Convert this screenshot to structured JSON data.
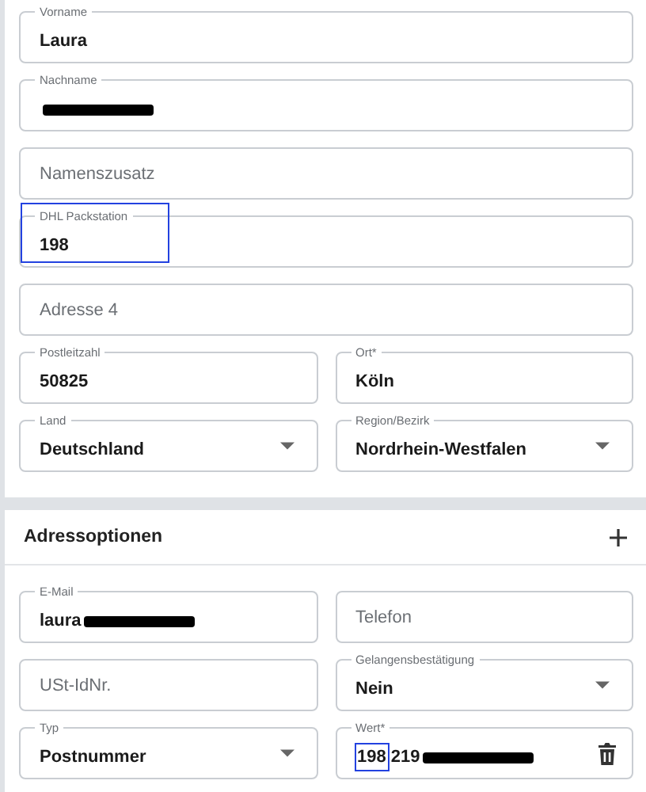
{
  "cards": [
    {
      "rows": [
        [
          {
            "kind": "text",
            "label": "Vorname",
            "value": "Laura",
            "redacted": false,
            "highlighted": false
          }
        ],
        [
          {
            "kind": "text",
            "label": "Nachname",
            "redacted": true,
            "highlighted": false
          }
        ],
        [
          {
            "kind": "text",
            "placeholder": "Namenszusatz",
            "redacted": false,
            "highlighted": false
          }
        ],
        [
          {
            "kind": "text",
            "label": "DHL Packstation",
            "value": "198",
            "redacted": false,
            "highlighted": true
          }
        ],
        [
          {
            "kind": "text",
            "placeholder": "Adresse 4",
            "redacted": false,
            "highlighted": false
          }
        ],
        [
          {
            "kind": "text",
            "label": "Postleitzahl",
            "value": "50825",
            "redacted": false,
            "highlighted": false
          },
          {
            "kind": "text",
            "label": "Ort*",
            "value": "Köln",
            "redacted": false,
            "highlighted": false
          }
        ],
        [
          {
            "kind": "select",
            "label": "Land",
            "value": "Deutschland",
            "redacted": false,
            "highlighted": false
          },
          {
            "kind": "select",
            "label": "Region/Bezirk",
            "value": "Nordrhein-Westfalen",
            "redacted": false,
            "highlighted": false
          }
        ]
      ]
    },
    {
      "title": "Adressoptionen",
      "addable": true,
      "rows": [
        [
          {
            "kind": "text",
            "label": "E-Mail",
            "value": "laura",
            "redacted": true,
            "highlighted": false
          },
          {
            "kind": "text",
            "placeholder": "Telefon",
            "redacted": false,
            "highlighted": false
          }
        ],
        [
          {
            "kind": "text",
            "placeholder": "USt-IdNr.",
            "redacted": false,
            "highlighted": false
          },
          {
            "kind": "select",
            "label": "Gelangensbestätigung",
            "value": "Nein",
            "redacted": false,
            "highlighted": false
          }
        ],
        [
          {
            "kind": "select",
            "label": "Typ",
            "value": "Postnummer",
            "redacted": false,
            "highlighted": false
          },
          {
            "kind": "deletable",
            "label": "Wert*",
            "value_segments": [
              {
                "text": "198",
                "highlighted": true
              },
              {
                "text": "219",
                "highlighted": false
              }
            ],
            "redacted": true,
            "highlighted": false
          }
        ]
      ]
    }
  ]
}
